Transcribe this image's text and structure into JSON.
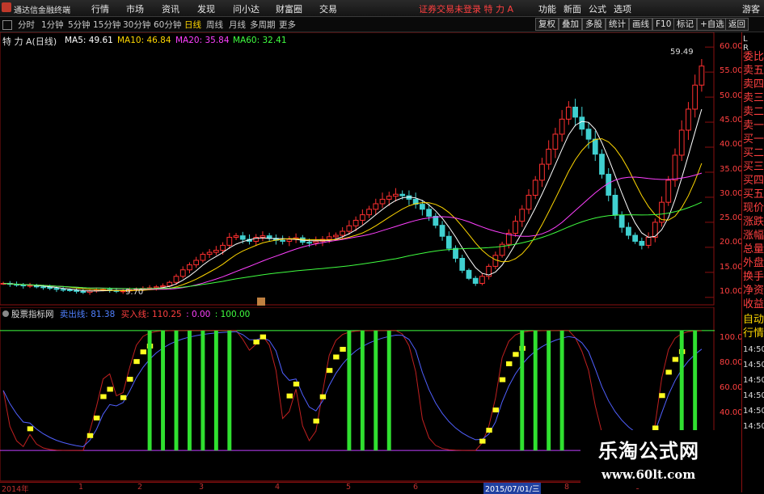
{
  "app": {
    "title": "通达信金融终端"
  },
  "menu": {
    "items": [
      "行情",
      "市场",
      "资讯",
      "发现",
      "问小达",
      "财富圈",
      "交易"
    ],
    "login_status": "证券交易未登录  特 力 A",
    "right_items": [
      "功能",
      "新面",
      "公式",
      "选项"
    ],
    "guest": "游客"
  },
  "toolbar": {
    "periods": [
      "分时",
      "1分钟",
      "5分钟",
      "15分钟",
      "30分钟",
      "60分钟",
      "日线",
      "周线",
      "月线",
      "多周期",
      "更多"
    ],
    "active": "日线",
    "right_buttons": [
      "复权",
      "叠加",
      "多股",
      "统计",
      "画线",
      "F10",
      "标记",
      "+自选",
      "返回"
    ]
  },
  "stock": {
    "name": "特 力 A",
    "period": "(日线)"
  },
  "ma": {
    "ma5": "MA5: 49.61",
    "ma10": "MA10: 46.84",
    "ma20": "MA20: 35.84",
    "ma60": "MA60: 32.41",
    "colors": {
      "ma5": "#ffffff",
      "ma10": "#ffd700",
      "ma20": "#ff40ff",
      "ma60": "#40ff40"
    }
  },
  "price_axis": [
    "60.00",
    "55.00",
    "50.00",
    "45.00",
    "40.00",
    "35.00",
    "30.00",
    "25.00",
    "20.00",
    "15.00",
    "10.00"
  ],
  "annotations": {
    "high": "59.49",
    "low": "9.70"
  },
  "indicator": {
    "name": "股票指标网",
    "sell_line": "卖出线: 81.38",
    "buy_line": "买入线: 110.25",
    "zero": ": 0.00",
    "hundred": ": 100.00"
  },
  "ind_axis": [
    "100.00",
    "80.00",
    "60.00",
    "40.00"
  ],
  "dates": [
    "2014年",
    "1",
    "2",
    "3",
    "4",
    "5",
    "6",
    "2015/07/01/三",
    "8",
    "9"
  ],
  "side_panel": {
    "tab_l": "L",
    "tab_r": "R",
    "items": [
      "委比",
      "卖五",
      "卖四",
      "卖三",
      "卖二",
      "卖一",
      "买一",
      "买二",
      "买三",
      "买四",
      "买五",
      "现价",
      "涨跌",
      "涨幅",
      "总量",
      "外盘",
      "换手",
      "净资",
      "收益",
      "自动",
      "行情"
    ],
    "times": [
      "14:50",
      "14:50",
      "14:50",
      "14:50",
      "14:50",
      "14:50"
    ]
  },
  "watermark": {
    "title": "乐淘公式网",
    "url": "www.60lt.com"
  },
  "chart_data": {
    "type": "candlestick",
    "y_range": [
      9.0,
      61.0
    ],
    "ma_labels": [
      "MA5",
      "MA10",
      "MA20",
      "MA60"
    ],
    "close": [
      12.8,
      12.6,
      12.5,
      12.3,
      12.4,
      12.1,
      12.0,
      11.8,
      11.6,
      11.5,
      11.4,
      11.2,
      11.0,
      11.3,
      11.5,
      11.6,
      11.4,
      11.2,
      11.3,
      11.5,
      11.7,
      11.8,
      11.9,
      12.1,
      12.3,
      13.0,
      14.2,
      15.5,
      16.5,
      17.4,
      18.6,
      19.0,
      19.4,
      20.4,
      22.0,
      22.3,
      21.6,
      21.2,
      22.0,
      22.3,
      21.8,
      21.4,
      21.2,
      21.6,
      21.9,
      21.0,
      20.9,
      21.2,
      21.6,
      22.1,
      22.4,
      23.2,
      24.3,
      25.4,
      26.5,
      27.6,
      28.7,
      29.6,
      30.2,
      30.6,
      30.3,
      29.6,
      28.6,
      27.6,
      26.2,
      24.4,
      22.2,
      19.8,
      17.8,
      15.4,
      13.8,
      12.8,
      14.2,
      16.2,
      18.4,
      20.6,
      22.8,
      25.2,
      27.6,
      30.4,
      33.4,
      36.6,
      39.6,
      42.6,
      45.6,
      48.0,
      46.0,
      43.6,
      41.6,
      38.6,
      34.6,
      30.4,
      26.4,
      24.0,
      22.4,
      21.2,
      20.4,
      22.0,
      25.0,
      29.0,
      33.4,
      38.4,
      43.4,
      47.6,
      52.4,
      56.2
    ],
    "indicator_lines": [
      "卖出线",
      "买入线"
    ],
    "ind_range": [
      -10,
      110
    ]
  }
}
